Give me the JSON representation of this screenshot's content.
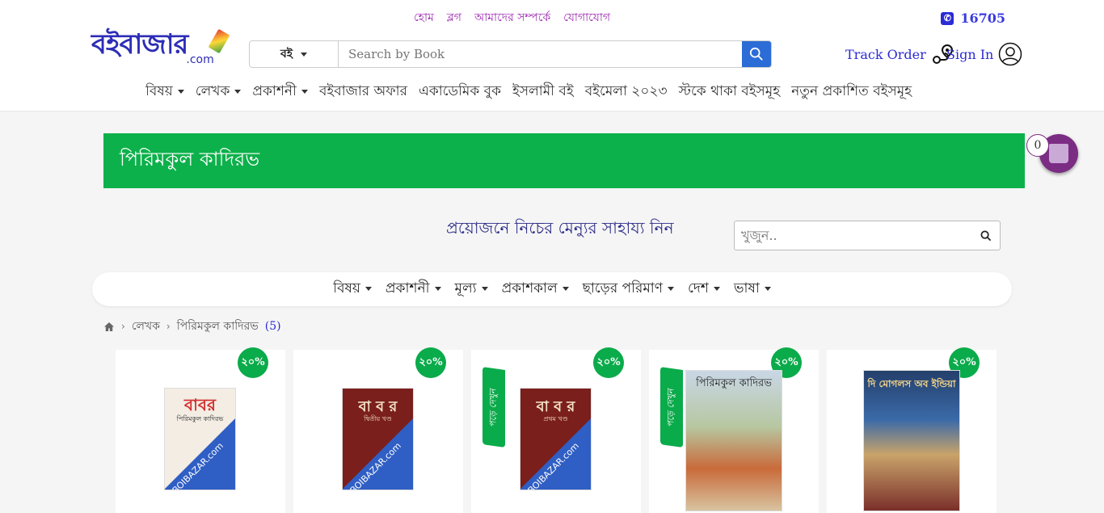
{
  "top_links": [
    "হোম",
    "ব্লগ",
    "আমাদের সম্পর্কে",
    "যোগাযোগ"
  ],
  "hotline": "16705",
  "logo": {
    "main": "বইবাজার",
    "suffix": ".com"
  },
  "search": {
    "category": "বই",
    "placeholder": "Search by Book"
  },
  "track_order": "Track Order",
  "sign_in": "Sign In",
  "nav": [
    "বিষয়",
    "লেখক",
    "প্রকাশনী",
    "বইবাজার অফার",
    "একাডেমিক বুক",
    "ইসলামী বই",
    "বইমেলা ২০২৩",
    "স্টকে থাকা বইসমূহ",
    "নতুন প্রকাশিত বইসমূহ"
  ],
  "nav_dropdown": [
    true,
    true,
    true,
    false,
    false,
    false,
    false,
    false,
    false
  ],
  "banner_title": "পিরিমকুল কাদিরভ",
  "cart_count": "0",
  "help_text": "প্রয়োজনে নিচের মেন্যুর সাহায্য নিন",
  "filter_search_placeholder": "খুজুন..",
  "filters": [
    "বিষয়",
    "প্রকাশনী",
    "মূল্য",
    "প্রকাশকাল",
    "ছাড়ের পরিমাণ",
    "দেশ",
    "ভাষা"
  ],
  "breadcrumb": {
    "section": "লেখক",
    "author": "পিরিমকুল কাদিরভ",
    "count": "(5)"
  },
  "books": [
    {
      "discount": "২০%",
      "cover_title": "বাবর",
      "cover_sub": "পিরিমকুল কাদিরভ",
      "read_label": "",
      "watermark": "BOIBAZAR.com",
      "colors": [
        "#f3ede4",
        "#d32f2f"
      ]
    },
    {
      "discount": "২০%",
      "cover_title": "বা ব র",
      "cover_sub": "দ্বিতীয় খণ্ড",
      "read_label": "",
      "watermark": "BOIBAZAR.com",
      "colors": [
        "#7a1f1c",
        "#f2e2c4"
      ]
    },
    {
      "discount": "২০%",
      "cover_title": "বা ব র",
      "cover_sub": "প্রথম খণ্ড",
      "read_label": "পড়ে দেখুন",
      "watermark": "BOIBAZAR.com",
      "colors": [
        "#7a1f1c",
        "#f2e2c4"
      ]
    },
    {
      "discount": "২০%",
      "cover_title": "পিরিমকুল কাদিরভ",
      "cover_sub": "",
      "read_label": "পড়ে দেখুন",
      "watermark": "",
      "colors": [
        "#c9d7e6",
        "#222222"
      ]
    },
    {
      "discount": "২০%",
      "cover_title": "দি মোগলস অব ইন্ডিয়া",
      "cover_sub": "",
      "read_label": "",
      "watermark": "",
      "colors": [
        "#243f6b",
        "#f4d58a"
      ]
    }
  ],
  "colors": {
    "accent_green": "#0db14b",
    "brand_blue": "#2b2bd6",
    "link_purple": "#9c27b0",
    "cart_purple": "#7b2c83"
  }
}
